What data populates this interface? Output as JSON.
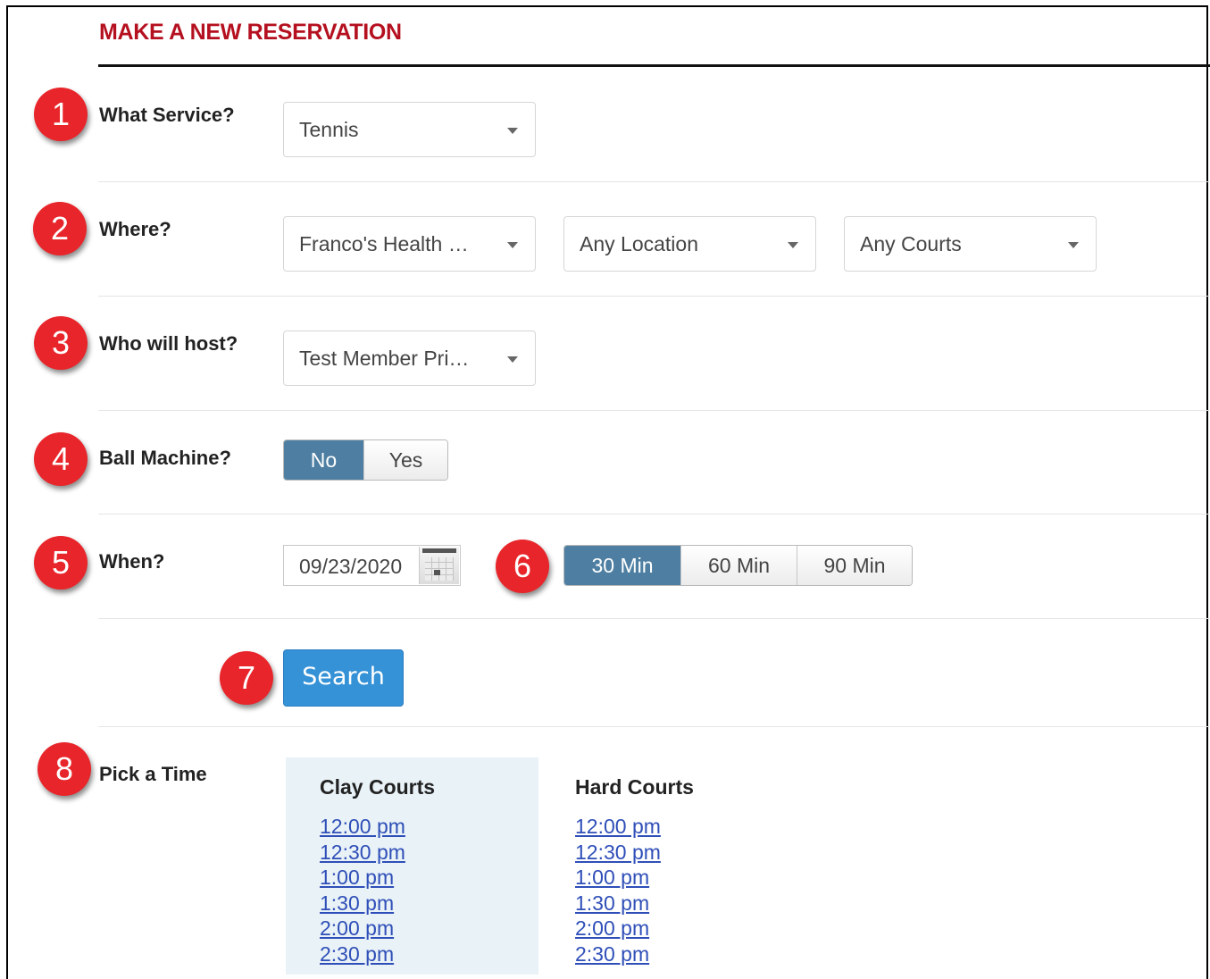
{
  "page": {
    "title": "MAKE A NEW RESERVATION"
  },
  "badges": [
    "1",
    "2",
    "3",
    "4",
    "5",
    "6",
    "7",
    "8"
  ],
  "service": {
    "label": "What Service?",
    "selected": "Tennis"
  },
  "where": {
    "label": "Where?",
    "club": "Franco's Health …",
    "location": "Any Location",
    "courts": "Any Courts"
  },
  "host": {
    "label": "Who will host?",
    "selected": "Test Member Pri…"
  },
  "ball_machine": {
    "label": "Ball Machine?",
    "options": [
      "No",
      "Yes"
    ],
    "selected": "No"
  },
  "when": {
    "label": "When?",
    "date": "09/23/2020"
  },
  "duration": {
    "options": [
      "30 Min",
      "60 Min",
      "90 Min"
    ],
    "selected": "30 Min"
  },
  "search": {
    "label": "Search"
  },
  "pick_time": {
    "label": "Pick a Time",
    "columns": [
      {
        "title": "Clay Courts",
        "times": [
          "12:00 pm",
          "12:30 pm",
          "1:00 pm",
          "1:30 pm",
          "2:00 pm",
          "2:30 pm"
        ]
      },
      {
        "title": "Hard Courts",
        "times": [
          "12:00 pm",
          "12:30 pm",
          "1:00 pm",
          "1:30 pm",
          "2:00 pm",
          "2:30 pm"
        ]
      }
    ]
  },
  "colors": {
    "title_red": "#b5101f",
    "badge_red": "#e8252a",
    "active_segment": "#4e7fa2",
    "search_blue": "#3592d7",
    "link_blue": "#2f4fb8",
    "clay_column_bg": "#e9f2f7"
  },
  "icons": {
    "date_picker": "calendar-icon",
    "select_arrow": "caret-down-icon"
  }
}
